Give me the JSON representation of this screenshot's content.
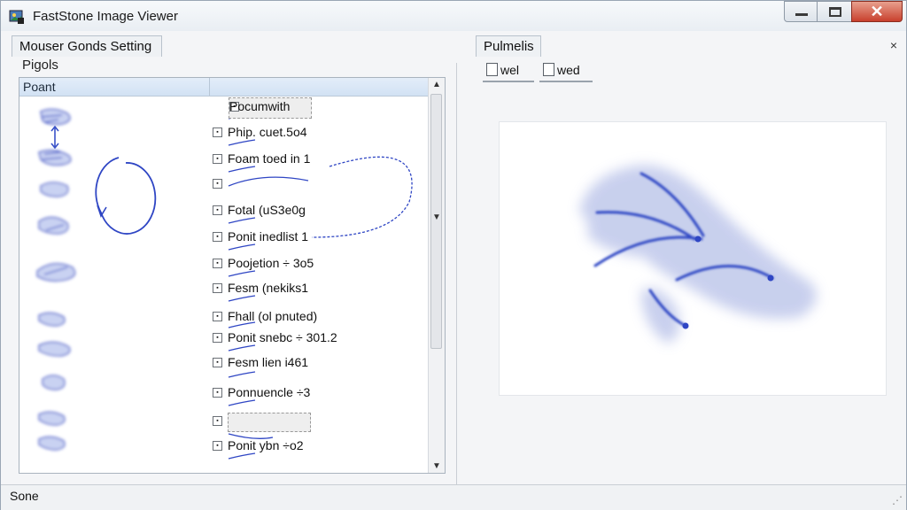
{
  "window": {
    "title": "FastStone Image Viewer",
    "close_glyph": "✕"
  },
  "left_panel": {
    "tab_label": "Mouser Gonds Setting",
    "sub_label": "Pigols",
    "list_header": "Poant",
    "rows": [
      {
        "label": "Pocumwith",
        "selected": true
      },
      {
        "label": "Phip. cuet.5o4",
        "selected": false
      },
      {
        "label": "Foam toed in 1",
        "selected": false
      },
      {
        "label": "",
        "selected": false
      },
      {
        "label": "Fotal (uS3e0g",
        "selected": false
      },
      {
        "label": "Ponit inedlist 1",
        "selected": false
      },
      {
        "label": "Poojetion ÷ 3o5",
        "selected": false
      },
      {
        "label": "Fesm (nekiks1",
        "selected": false
      },
      {
        "label": "Fhall (ol pnuted)",
        "selected": false
      },
      {
        "label": "Ponit snebc ÷ 301.2",
        "selected": false
      },
      {
        "label": "Fesm lien i461",
        "selected": false
      },
      {
        "label": "Ponnuencle ÷3",
        "selected": false
      },
      {
        "label": "",
        "selected": true
      },
      {
        "label": "Ponit ybn ÷o2",
        "selected": false
      }
    ],
    "scroll_up": "▲",
    "scroll_mid": "▼",
    "scroll_down": "▼"
  },
  "right_panel": {
    "tab_label": "Pulmelis",
    "close_glyph": "×",
    "toolbar": [
      {
        "label": "wel",
        "icon": "document-icon"
      },
      {
        "label": "wed",
        "icon": "document-icon"
      }
    ]
  },
  "status": {
    "text": "Sone",
    "grip": "⋰"
  },
  "colors": {
    "gesture_blue": "#2f46c4",
    "header_bg": "#d8e6f6",
    "close_red": "#c8402d"
  }
}
